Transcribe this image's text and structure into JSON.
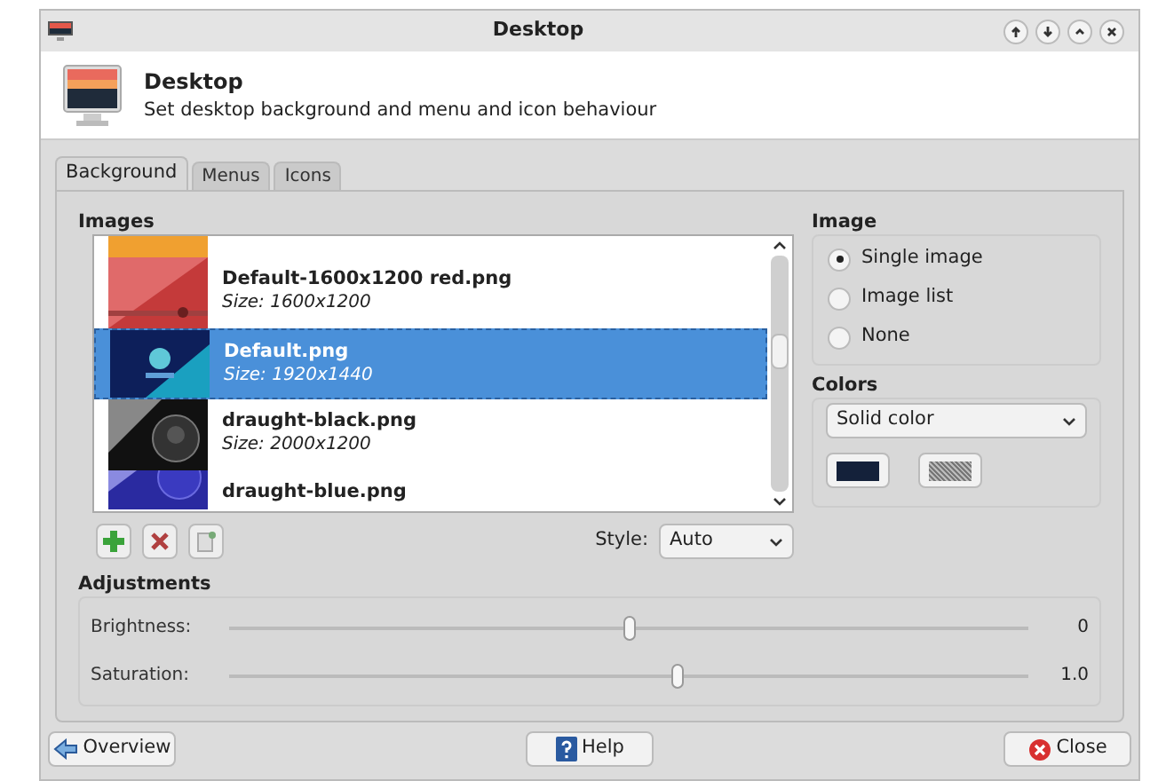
{
  "window": {
    "title": "Desktop"
  },
  "header": {
    "title": "Desktop",
    "subtitle": "Set desktop background and menu and icon behaviour"
  },
  "tabs": [
    {
      "label": "Background",
      "selected": true
    },
    {
      "label": "Menus",
      "selected": false
    },
    {
      "label": "Icons",
      "selected": false
    }
  ],
  "images": {
    "title": "Images",
    "items": [
      {
        "kind": "picture",
        "selected": false
      },
      {
        "kind": "picture",
        "name": "Default-1600x1200 red.png",
        "size": "Size: 1600x1200",
        "selected": false
      },
      {
        "kind": "picture",
        "name": "Default.png",
        "size": "Size: 1920x1440",
        "selected": true
      },
      {
        "kind": "picture",
        "name": "draught-black.png",
        "size": "Size: 2000x1200",
        "selected": false
      },
      {
        "kind": "picture",
        "name": "draught-blue.png",
        "selected": false
      }
    ]
  },
  "style": {
    "label": "Style:",
    "value": "Auto"
  },
  "adjustments": {
    "title": "Adjustments",
    "sliders": [
      {
        "label": "Brightness:",
        "level": 0.5,
        "reading": "0"
      },
      {
        "label": "Saturation:",
        "level": 0.56,
        "reading": "1.0"
      }
    ]
  },
  "image_mode": {
    "title": "Image",
    "options": [
      {
        "label": "Single image",
        "selected": true
      },
      {
        "label": "Image list",
        "selected": false
      },
      {
        "label": "None",
        "selected": false
      }
    ]
  },
  "colors": {
    "title": "Colors",
    "mode": "Solid color",
    "swatches": [
      {
        "kind": "solid",
        "color": "#14213a"
      },
      {
        "kind": "pattern"
      }
    ]
  },
  "buttons": [
    {
      "label": "Overview",
      "kind": "back"
    },
    {
      "label": "Help",
      "kind": "help"
    },
    {
      "label": "Close",
      "kind": "close"
    }
  ]
}
